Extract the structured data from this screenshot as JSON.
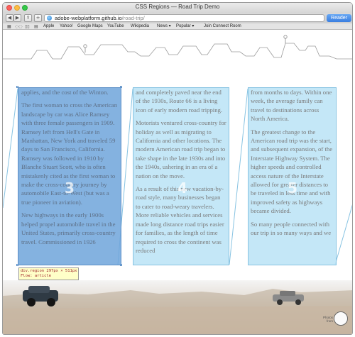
{
  "window": {
    "title": "CSS Regions — Road Trip Demo"
  },
  "toolbar": {
    "url_host": "adobe-webplatform.github.io",
    "url_path": "/road-trip/",
    "reader_label": "Reader"
  },
  "bookmarks": {
    "items": [
      "Apple",
      "Yahoo!",
      "Google Maps",
      "YouTube",
      "Wikipedia",
      "News ▾",
      "Popular ▾",
      "Join Connect Room"
    ]
  },
  "regions": [
    {
      "number": "3",
      "paragraphs": [
        "applies, and the cost of the Winton.",
        "The first woman to cross the American landscape by car was Alice Ramsey with three female passengers in 1909. Ramsey left from Hell's Gate in Manhattan, New York and traveled 59 days to San Francisco, California. Ramsey was followed in 1910 by Blanche Stuart Scott, who is often mistakenly cited as the first woman to make the cross-country journey by automobile East-to-West (but was a true pioneer in aviation).",
        "New highways in the early 1900s helped propel automobile travel in the United States, primarily cross-country travel. Commissioned in 1926"
      ]
    },
    {
      "number": "4",
      "paragraphs": [
        "and completely paved near the end of the 1930s, Route 66 is a living icon of early modern road tripping.",
        "Motorists ventured cross-country for holiday as well as migrating to California and other locations. The modern American road trip began to take shape in the late 1930s and into the 1940s, ushering in an era of a nation on the move.",
        "As a result of this new vacation-by-road style, many businesses began to cater to road-weary travelers. More reliable vehicles and services made long distance road trips easier for families, as the length of time required to cross the continent was reduced"
      ]
    },
    {
      "number": "5",
      "paragraphs": [
        "from months to days. Within one week, the average family can travel to destinations across North America.",
        "The greatest change to the American road trip was the start, and subsequent expansion, of the Interstate Highway System. The higher speeds and controlled access nature of the Interstate allowed for greater distances to be traveled in less time and with improved safety as highways became divided.",
        "So many people connected with our trip in so many ways and we"
      ]
    }
  ],
  "inspector": {
    "line1": "div.region 297px × 511px",
    "line2": "Flow: article"
  },
  "footer": {
    "logo_text": "Photos from",
    "logo_icon": "sketch-logo-icon"
  }
}
